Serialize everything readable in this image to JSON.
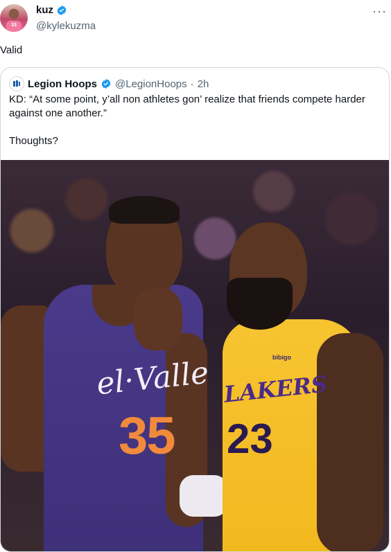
{
  "tweet": {
    "author_name": "kuz",
    "author_handle": "@kylekuzma",
    "text": "Valid",
    "avatar_jersey_number": "33",
    "more_label": "···"
  },
  "quoted": {
    "author_name": "Legion Hoops",
    "author_handle": "@LegionHoops",
    "separator": "·",
    "time": "2h",
    "text": "KD: “At some point, y’all non athletes gon’ realize that friends compete harder against one another.”\n\nThoughts?",
    "photo": {
      "left_jersey_text": "el·Valle",
      "left_jersey_number": "35",
      "right_jersey_text": "LAKERS",
      "right_jersey_number": "23",
      "sponsor": "bibigo"
    }
  },
  "colors": {
    "verified": "#1d9bf0",
    "secondary_text": "#536471",
    "border": "#cfd9de"
  }
}
